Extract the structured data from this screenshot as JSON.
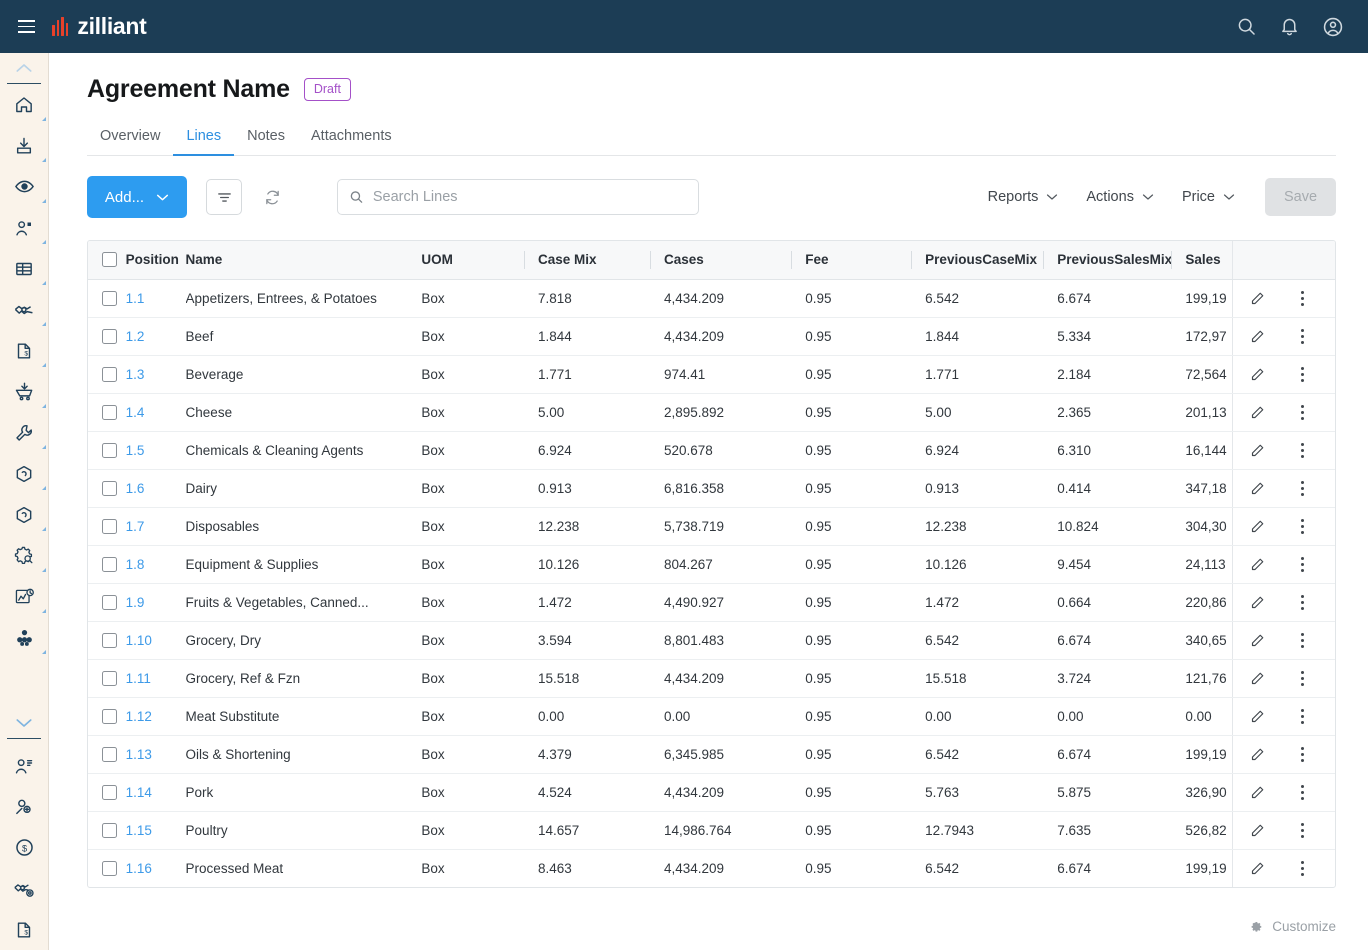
{
  "topbar": {
    "menu_icon": "hamburger-icon",
    "brand_name": "zilliant",
    "icons": [
      {
        "name": "search-icon",
        "label": "Search"
      },
      {
        "name": "notifications-bell-icon",
        "label": "Notifications"
      },
      {
        "name": "user-account-icon",
        "label": "Account"
      }
    ]
  },
  "sidebar": {
    "scroll_up": "chevron-up-icon",
    "scroll_down": "chevron-down-icon",
    "items": [
      {
        "name": "home-icon",
        "label": "Home",
        "caret": true
      },
      {
        "name": "download-inbox-icon",
        "label": "Imports",
        "caret": true
      },
      {
        "name": "eye-icon",
        "label": "Views",
        "caret": true
      },
      {
        "name": "customer-icon",
        "label": "Customers",
        "caret": true
      },
      {
        "name": "table-grid-icon",
        "label": "Grids",
        "caret": true
      },
      {
        "name": "handshake-icon",
        "label": "Agreements",
        "caret": true
      },
      {
        "name": "document-dollar-icon",
        "label": "Quotes",
        "caret": true
      },
      {
        "name": "cart-download-icon",
        "label": "Orders",
        "caret": true
      },
      {
        "name": "wrench-icon",
        "label": "Tools",
        "caret": true
      },
      {
        "name": "package-outline-icon",
        "label": "Products",
        "caret": true
      },
      {
        "name": "package-icon",
        "label": "Catalog",
        "caret": true
      },
      {
        "name": "gear-search-icon",
        "label": "Admin",
        "caret": true
      },
      {
        "name": "analytics-clock-icon",
        "label": "Analytics",
        "caret": true
      },
      {
        "name": "cubes-icon",
        "label": "Bundles",
        "caret": true
      }
    ],
    "items_lower": [
      {
        "name": "customer-list-icon",
        "label": "Customer List",
        "caret": false
      },
      {
        "name": "add-user-icon",
        "label": "Add User",
        "caret": false
      },
      {
        "name": "dollar-circle-icon",
        "label": "Pricing",
        "caret": false
      },
      {
        "name": "handshake-settings-icon",
        "label": "Agreement Settings",
        "caret": false
      },
      {
        "name": "document-dollar-icon",
        "label": "Price Document",
        "caret": false
      }
    ]
  },
  "page": {
    "title": "Agreement Name",
    "status": "Draft"
  },
  "tabs": [
    {
      "label": "Overview",
      "active": false
    },
    {
      "label": "Lines",
      "active": true
    },
    {
      "label": "Notes",
      "active": false
    },
    {
      "label": "Attachments",
      "active": false
    }
  ],
  "toolbar": {
    "add_label": "Add...",
    "filter_icon": "filter-icon",
    "refresh_icon": "refresh-icon",
    "reports_label": "Reports",
    "actions_label": "Actions",
    "price_label": "Price",
    "save_label": "Save"
  },
  "search": {
    "placeholder": "Search Lines",
    "value": "",
    "icon": "search-icon"
  },
  "table": {
    "columns": [
      {
        "key": "checkbox",
        "label": ""
      },
      {
        "key": "position",
        "label": "Position"
      },
      {
        "key": "name",
        "label": "Name"
      },
      {
        "key": "uom",
        "label": "UOM"
      },
      {
        "key": "case_mix",
        "label": "Case Mix"
      },
      {
        "key": "cases",
        "label": "Cases"
      },
      {
        "key": "fee",
        "label": "Fee"
      },
      {
        "key": "previous_case_mix",
        "label": "PreviousCaseMix"
      },
      {
        "key": "previous_sales_mix",
        "label": "PreviousSalesMix"
      },
      {
        "key": "sales",
        "label": "Sales"
      }
    ],
    "rows": [
      {
        "position": "1.1",
        "name": "Appetizers, Entrees, & Potatoes",
        "uom": "Box",
        "case_mix": "7.818",
        "cases": "4,434.209",
        "fee": "0.95",
        "previous_case_mix": "6.542",
        "previous_sales_mix": "6.674",
        "sales": "199,19"
      },
      {
        "position": "1.2",
        "name": "Beef",
        "uom": "Box",
        "case_mix": "1.844",
        "cases": "4,434.209",
        "fee": "0.95",
        "previous_case_mix": "1.844",
        "previous_sales_mix": "5.334",
        "sales": "172,97"
      },
      {
        "position": "1.3",
        "name": "Beverage",
        "uom": "Box",
        "case_mix": "1.771",
        "cases": "974.41",
        "fee": "0.95",
        "previous_case_mix": "1.771",
        "previous_sales_mix": "2.184",
        "sales": "72,564"
      },
      {
        "position": "1.4",
        "name": "Cheese",
        "uom": "Box",
        "case_mix": "5.00",
        "cases": "2,895.892",
        "fee": "0.95",
        "previous_case_mix": "5.00",
        "previous_sales_mix": "2.365",
        "sales": "201,13"
      },
      {
        "position": "1.5",
        "name": "Chemicals & Cleaning Agents",
        "uom": "Box",
        "case_mix": "6.924",
        "cases": "520.678",
        "fee": "0.95",
        "previous_case_mix": "6.924",
        "previous_sales_mix": "6.310",
        "sales": "16,144"
      },
      {
        "position": "1.6",
        "name": "Dairy",
        "uom": "Box",
        "case_mix": "0.913",
        "cases": "6,816.358",
        "fee": "0.95",
        "previous_case_mix": "0.913",
        "previous_sales_mix": "0.414",
        "sales": "347,18"
      },
      {
        "position": "1.7",
        "name": "Disposables",
        "uom": "Box",
        "case_mix": "12.238",
        "cases": "5,738.719",
        "fee": "0.95",
        "previous_case_mix": "12.238",
        "previous_sales_mix": "10.824",
        "sales": "304,30"
      },
      {
        "position": "1.8",
        "name": "Equipment & Supplies",
        "uom": "Box",
        "case_mix": "10.126",
        "cases": "804.267",
        "fee": "0.95",
        "previous_case_mix": "10.126",
        "previous_sales_mix": "9.454",
        "sales": "24,113"
      },
      {
        "position": "1.9",
        "name": "Fruits & Vegetables, Canned...",
        "uom": "Box",
        "case_mix": "1.472",
        "cases": "4,490.927",
        "fee": "0.95",
        "previous_case_mix": "1.472",
        "previous_sales_mix": "0.664",
        "sales": "220,86"
      },
      {
        "position": "1.10",
        "name": "Grocery, Dry",
        "uom": "Box",
        "case_mix": "3.594",
        "cases": "8,801.483",
        "fee": "0.95",
        "previous_case_mix": "6.542",
        "previous_sales_mix": "6.674",
        "sales": "340,65"
      },
      {
        "position": "1.11",
        "name": "Grocery, Ref & Fzn",
        "uom": "Box",
        "case_mix": "15.518",
        "cases": "4,434.209",
        "fee": "0.95",
        "previous_case_mix": "15.518",
        "previous_sales_mix": "3.724",
        "sales": "121,76"
      },
      {
        "position": "1.12",
        "name": "Meat Substitute",
        "uom": "Box",
        "case_mix": "0.00",
        "cases": "0.00",
        "fee": "0.95",
        "previous_case_mix": "0.00",
        "previous_sales_mix": "0.00",
        "sales": "0.00"
      },
      {
        "position": "1.13",
        "name": "Oils & Shortening",
        "uom": "Box",
        "case_mix": "4.379",
        "cases": "6,345.985",
        "fee": "0.95",
        "previous_case_mix": "6.542",
        "previous_sales_mix": "6.674",
        "sales": "199,19"
      },
      {
        "position": "1.14",
        "name": "Pork",
        "uom": "Box",
        "case_mix": "4.524",
        "cases": "4,434.209",
        "fee": "0.95",
        "previous_case_mix": "5.763",
        "previous_sales_mix": "5.875",
        "sales": "326,90"
      },
      {
        "position": "1.15",
        "name": "Poultry",
        "uom": "Box",
        "case_mix": "14.657",
        "cases": "14,986.764",
        "fee": "0.95",
        "previous_case_mix": "12.7943",
        "previous_sales_mix": "7.635",
        "sales": "526,82"
      },
      {
        "position": "1.16",
        "name": "Processed Meat",
        "uom": "Box",
        "case_mix": "8.463",
        "cases": "4,434.209",
        "fee": "0.95",
        "previous_case_mix": "6.542",
        "previous_sales_mix": "6.674",
        "sales": "199,19"
      }
    ],
    "row_actions": {
      "edit_icon": "pencil-edit-icon",
      "more_icon": "kebab-more-icon"
    }
  },
  "footer": {
    "customize_label": "Customize",
    "customize_icon": "gear-icon"
  },
  "colors": {
    "navbar": "#1c3d55",
    "brand_accent": "#e8412a",
    "primary": "#2d9cf0",
    "link": "#3d9ae8",
    "status_draft": "#a450c8",
    "rail_bg": "#faf3ea"
  }
}
